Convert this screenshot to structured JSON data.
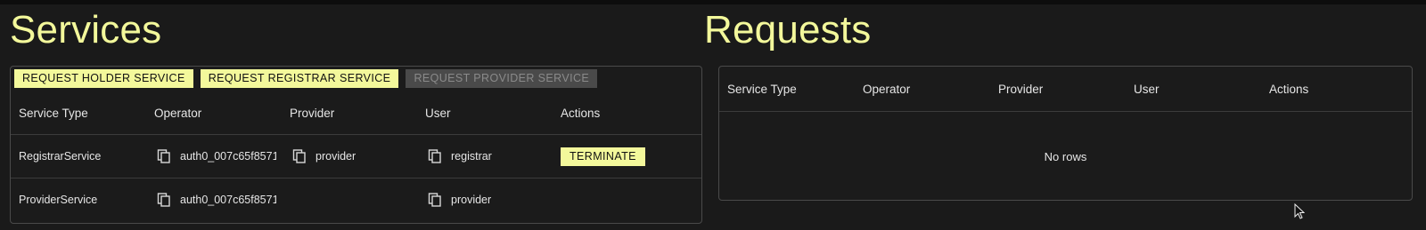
{
  "services": {
    "title": "Services",
    "buttons": {
      "request_holder": "REQUEST HOLDER SERVICE",
      "request_registrar": "REQUEST REGISTRAR SERVICE",
      "request_provider": "REQUEST PROVIDER SERVICE"
    },
    "columns": [
      "Service Type",
      "Operator",
      "Provider",
      "User",
      "Actions"
    ],
    "rows": [
      {
        "service_type": "RegistrarService",
        "operator": "auth0_007c65f8571",
        "provider": "provider",
        "user": "registrar",
        "action": "TERMINATE"
      },
      {
        "service_type": "ProviderService",
        "operator": "auth0_007c65f8571",
        "provider": "",
        "user": "provider",
        "action": ""
      }
    ]
  },
  "requests": {
    "title": "Requests",
    "columns": [
      "Service Type",
      "Operator",
      "Provider",
      "User",
      "Actions"
    ],
    "empty_text": "No rows"
  },
  "icons": {
    "copy": "copy-icon",
    "cursor": "mouse-pointer-icon"
  },
  "colors": {
    "accent": "#f3f89b",
    "background": "#1a1a1a",
    "disabled": "#4a4a4a",
    "border": "#4a4a4a"
  }
}
